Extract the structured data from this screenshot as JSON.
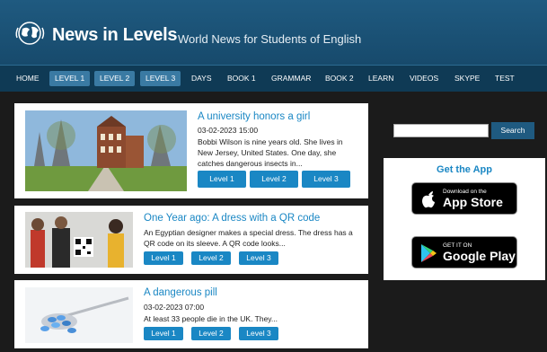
{
  "header": {
    "logo": "News in Levels",
    "tagline": "World News for Students of English"
  },
  "nav": [
    {
      "label": "HOME",
      "level": false
    },
    {
      "label": "LEVEL 1",
      "level": true
    },
    {
      "label": "LEVEL 2",
      "level": true
    },
    {
      "label": "LEVEL 3",
      "level": true
    },
    {
      "label": "DAYS",
      "level": false
    },
    {
      "label": "BOOK 1",
      "level": false
    },
    {
      "label": "GRAMMAR",
      "level": false
    },
    {
      "label": "BOOK 2",
      "level": false
    },
    {
      "label": "LEARN",
      "level": false
    },
    {
      "label": "VIDEOS",
      "level": false
    },
    {
      "label": "SKYPE",
      "level": false
    },
    {
      "label": "TEST",
      "level": false
    }
  ],
  "articles": [
    {
      "title": "A university honors a girl",
      "date": "03-02-2023 15:00",
      "excerpt": "Bobbi Wilson is nine years old. She lives in New Jersey, United States. One day, she catches dangerous insects in...",
      "buttons": [
        "Level 1",
        "Level 2",
        "Level 3"
      ]
    },
    {
      "title": "One Year ago: A dress with a QR code",
      "date": "",
      "excerpt": "An Egyptian designer makes a special dress. The dress has a QR code on its sleeve. A QR code looks...",
      "buttons": [
        "Level 1",
        "Level 2",
        "Level 3"
      ]
    },
    {
      "title": "A dangerous pill",
      "date": "03-02-2023 07:00",
      "excerpt": "At least 33 people die in the UK. They...",
      "buttons": [
        "Level 1",
        "Level 2",
        "Level 3"
      ]
    }
  ],
  "sidebar": {
    "search_button": "Search",
    "search_placeholder": "",
    "app_title": "Get the App",
    "app_store": {
      "small": "Download on the",
      "big": "App Store"
    },
    "google_play": {
      "small": "GET IT ON",
      "big": "Google Play"
    }
  },
  "colors": {
    "header": "#1f5a80",
    "nav": "#0f3a55",
    "accent": "#1a87c4",
    "background": "#1b1b1b"
  }
}
